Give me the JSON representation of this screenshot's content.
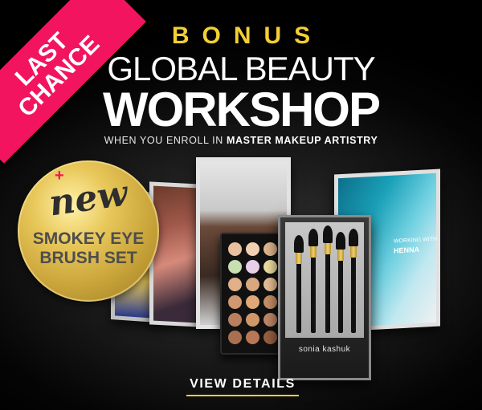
{
  "ribbon": {
    "line1": "LAST",
    "line2": "CHANCE",
    "color": "#f2145e"
  },
  "header": {
    "bonus": "BONUS",
    "title_line1": "GLOBAL BEAUTY",
    "title_line2": "WORKSHOP",
    "subline_prefix": "WHEN YOU ENROLL IN ",
    "subline_bold": "MASTER MAKEUP ARTISTRY",
    "bonus_color": "#f4cf35"
  },
  "badge": {
    "plus": "+",
    "new": "new",
    "line2": "SMOKEY EYE",
    "line3": "BRUSH SET"
  },
  "pages": {
    "page4_text1": "WORKING WITH",
    "page4_text2": "HENNA"
  },
  "brush_box": {
    "brand": "sonia kashuk"
  },
  "cta": {
    "label": "VIEW DETAILS"
  }
}
